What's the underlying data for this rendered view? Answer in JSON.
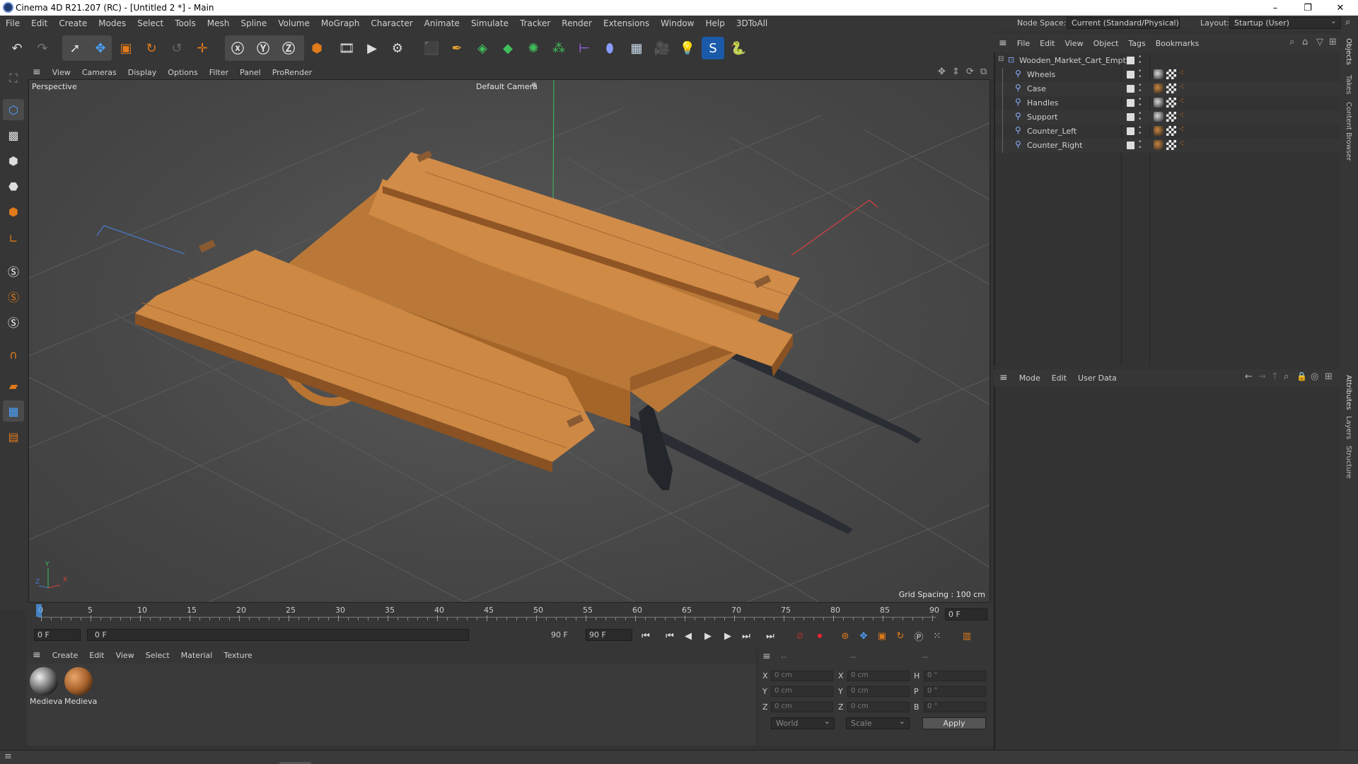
{
  "window": {
    "title": "Cinema 4D R21.207 (RC) - [Untitled 2 *] - Main"
  },
  "menubar": {
    "items": [
      "File",
      "Edit",
      "Create",
      "Modes",
      "Select",
      "Tools",
      "Mesh",
      "Spline",
      "Volume",
      "MoGraph",
      "Character",
      "Animate",
      "Simulate",
      "Tracker",
      "Render",
      "Extensions",
      "Window",
      "Help",
      "3DToAll"
    ],
    "node_space_label": "Node Space:",
    "node_space_value": "Current (Standard/Physical)",
    "layout_label": "Layout:",
    "layout_value": "Startup (User)"
  },
  "viewport": {
    "menu": [
      "View",
      "Cameras",
      "Display",
      "Options",
      "Filter",
      "Panel",
      "ProRender"
    ],
    "name": "Perspective",
    "camera": "Default Camera",
    "grid_spacing": "Grid Spacing : 100 cm",
    "axis": {
      "y": "Y",
      "z": "Z",
      "x": "X"
    }
  },
  "timeline": {
    "ticks": [
      "0",
      "5",
      "10",
      "15",
      "20",
      "25",
      "30",
      "35",
      "40",
      "45",
      "50",
      "55",
      "60",
      "65",
      "70",
      "75",
      "80",
      "85",
      "90"
    ],
    "current_frame": "0 F",
    "start_frame": "0 F",
    "range_start": "0 F",
    "range_end": "90 F",
    "end_frame": "90 F"
  },
  "material_manager": {
    "menu": [
      "Create",
      "Edit",
      "View",
      "Select",
      "Material",
      "Texture"
    ],
    "materials": [
      {
        "name": "Medieva"
      },
      {
        "name": "Medieva"
      }
    ]
  },
  "coordinates": {
    "header": [
      "--",
      "--",
      "--"
    ],
    "rows": [
      {
        "l1": "X",
        "v1": "0 cm",
        "l2": "X",
        "v2": "0 cm",
        "l3": "H",
        "v3": "0 °"
      },
      {
        "l1": "Y",
        "v1": "0 cm",
        "l2": "Y",
        "v2": "0 cm",
        "l3": "P",
        "v3": "0 °"
      },
      {
        "l1": "Z",
        "v1": "0 cm",
        "l2": "Z",
        "v2": "0 cm",
        "l3": "B",
        "v3": "0 °"
      }
    ],
    "space": "World",
    "mode": "Scale",
    "apply": "Apply"
  },
  "object_manager": {
    "menu": [
      "File",
      "Edit",
      "View",
      "Object",
      "Tags",
      "Bookmarks"
    ],
    "root": "Wooden_Market_Cart_Empty",
    "children": [
      "Wheels",
      "Case",
      "Handles",
      "Support",
      "Counter_Left",
      "Counter_Right"
    ]
  },
  "attributes": {
    "menu": [
      "Mode",
      "Edit",
      "User Data"
    ]
  },
  "side_tabs": [
    "Objects",
    "Takes",
    "Content Browser",
    "Attributes",
    "Layers",
    "Structure"
  ],
  "colors": {
    "accent": "#e07a1a",
    "wood": "#c8843e",
    "axis_y": "#3fbf5a",
    "axis_x": "#d94040",
    "axis_z": "#4a7ad0"
  }
}
